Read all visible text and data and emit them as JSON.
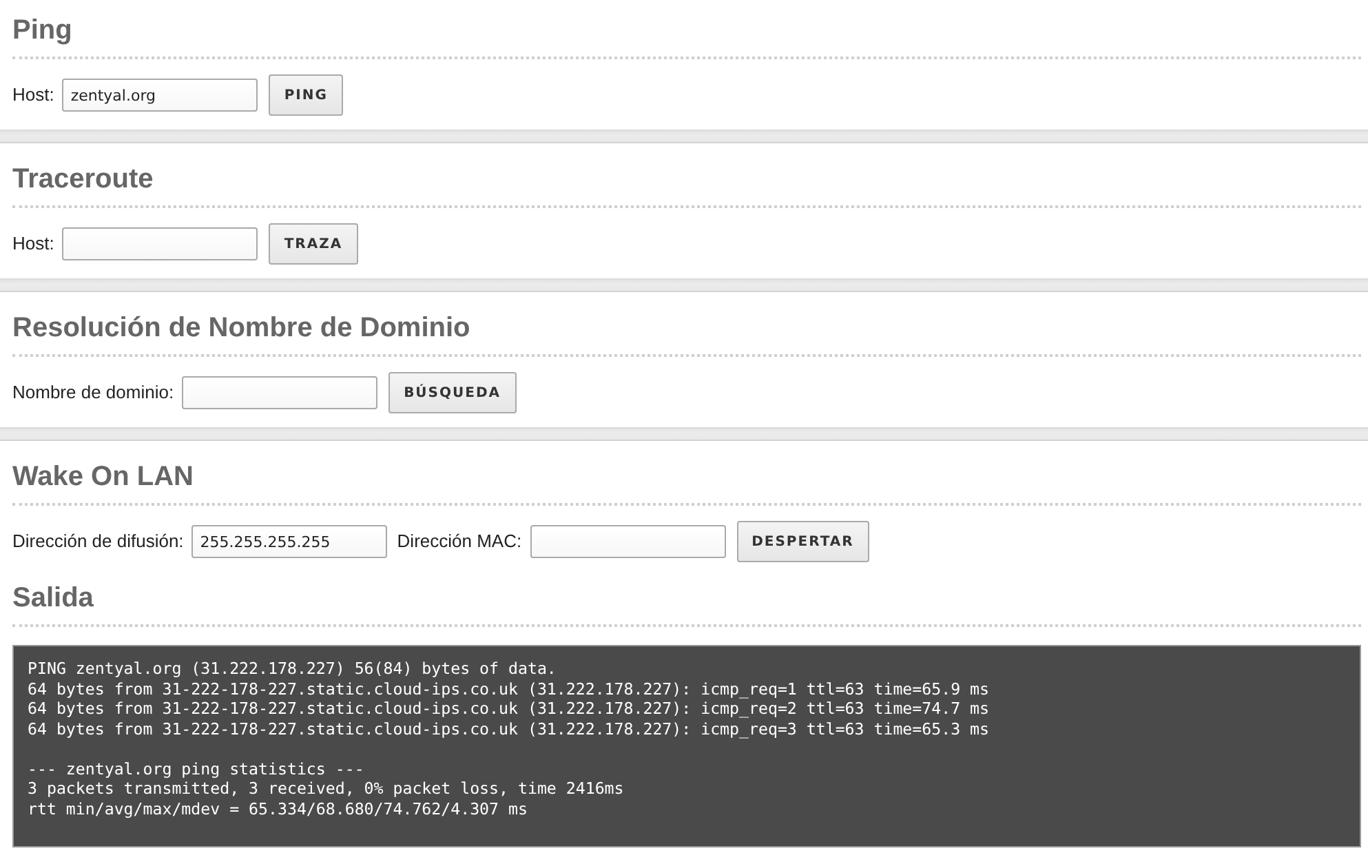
{
  "tools": [
    {
      "title": "Ping",
      "fields": [
        {
          "label": "Host:",
          "value": "zentyal.org"
        }
      ],
      "button": "PING"
    },
    {
      "title": "Traceroute",
      "fields": [
        {
          "label": "Host:"
        }
      ],
      "button": "TRAZA"
    },
    {
      "title": "Resolución de Nombre de Dominio",
      "fields": [
        {
          "label": "Nombre de dominio:"
        }
      ],
      "button": "BÚSQUEDA"
    },
    {
      "title": "Wake On LAN",
      "fields": [
        {
          "label": "Dirección de difusión:",
          "value": "255.255.255.255"
        },
        {
          "label": "Dirección MAC:"
        }
      ],
      "button": "DESPERTAR"
    }
  ],
  "output": {
    "title": "Salida",
    "blocks": [
      [
        "PING zentyal.org (31.222.178.227) 56(84) bytes of data.",
        "64 bytes from 31-222-178-227.static.cloud-ips.co.uk (31.222.178.227): icmp_req=1 ttl=63 time=65.9 ms",
        "64 bytes from 31-222-178-227.static.cloud-ips.co.uk (31.222.178.227): icmp_req=2 ttl=63 time=74.7 ms",
        "64 bytes from 31-222-178-227.static.cloud-ips.co.uk (31.222.178.227): icmp_req=3 ttl=63 time=65.3 ms"
      ],
      [
        "--- zentyal.org ping statistics ---",
        "3 packets transmitted, 3 received, 0% packet loss, time 2416ms",
        "rtt min/avg/max/mdev = 65.334/68.680/74.762/4.307 ms"
      ]
    ]
  }
}
